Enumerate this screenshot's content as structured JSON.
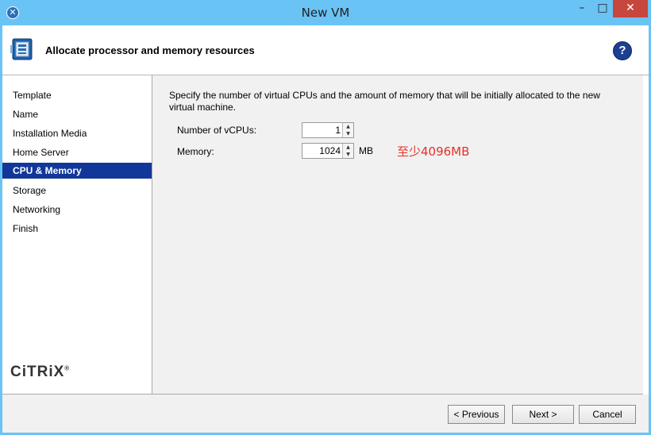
{
  "window": {
    "title": "New VM",
    "minimize_glyph": "–",
    "maximize_glyph": "□",
    "close_glyph": "✕",
    "app_icon": "xencenter-icon"
  },
  "header": {
    "title": "Allocate processor and memory resources",
    "icon": "vm-icon",
    "help_label": "?"
  },
  "nav": {
    "items": [
      {
        "label": "Template",
        "active": false
      },
      {
        "label": "Name",
        "active": false
      },
      {
        "label": "Installation Media",
        "active": false
      },
      {
        "label": "Home Server",
        "active": false
      },
      {
        "label": "CPU & Memory",
        "active": true
      },
      {
        "label": "Storage",
        "active": false
      },
      {
        "label": "Networking",
        "active": false
      },
      {
        "label": "Finish",
        "active": false
      }
    ],
    "logo": "CiTRiX",
    "logo_mark": "®"
  },
  "content": {
    "description": "Specify the number of virtual CPUs and the amount of memory that will be initially allocated to the new virtual machine.",
    "vcpus": {
      "label": "Number of vCPUs:",
      "value": "1"
    },
    "memory": {
      "label": "Memory:",
      "value": "1024",
      "unit": "MB"
    },
    "annotation": "至少4096MB"
  },
  "footer": {
    "previous_label": "< Previous",
    "next_label": "Next >",
    "cancel_label": "Cancel"
  },
  "colors": {
    "titlebar": "#6ac3f5",
    "nav_active": "#12379b",
    "annotation": "#e3322b",
    "close_button": "#c7463e"
  }
}
